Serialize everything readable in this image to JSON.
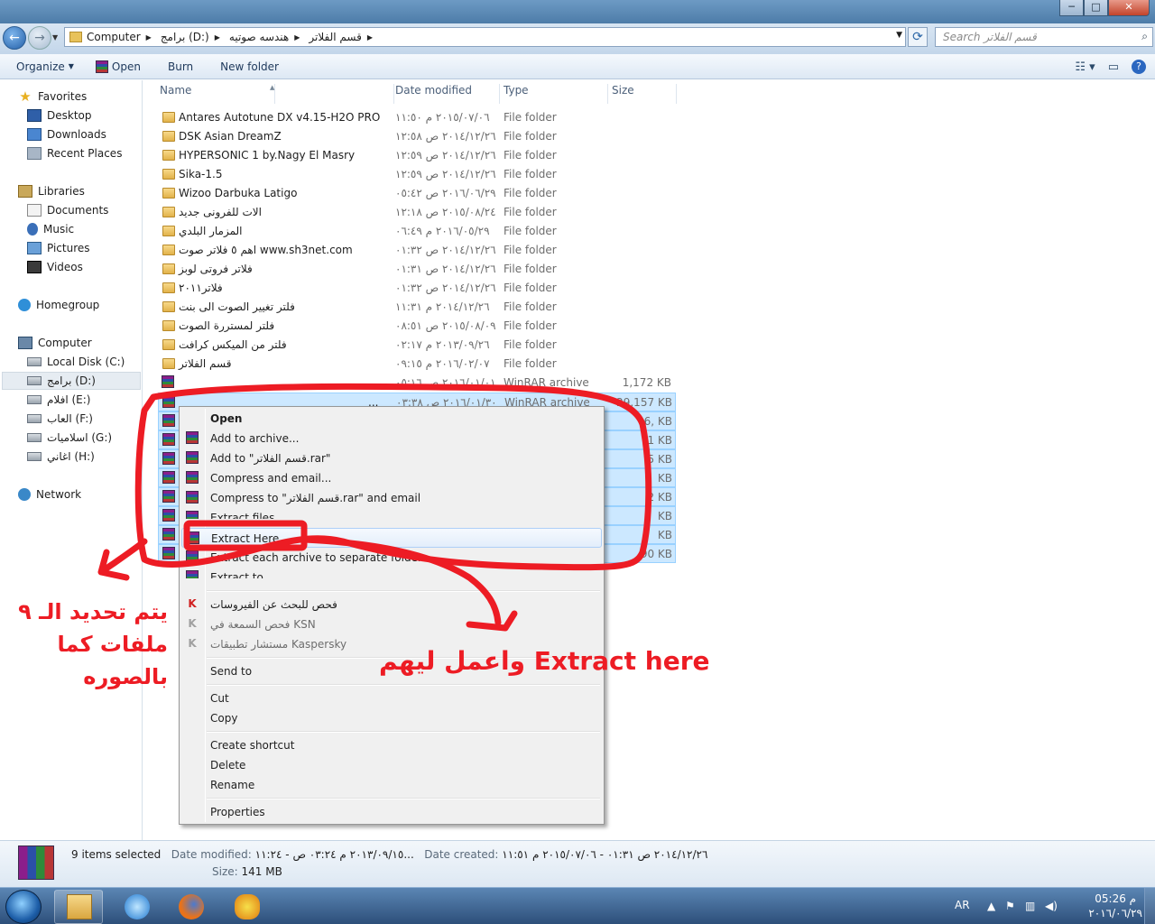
{
  "window": {
    "minimize": "─",
    "maximize": "□",
    "close": "✕"
  },
  "address": {
    "crumbs": [
      "Computer",
      "برامج (D:)",
      "هندسه صوتيه",
      "قسم الفلاتر"
    ],
    "search_placeholder": "Search قسم الفلاتر"
  },
  "toolbar": {
    "organize": "Organize",
    "open": "Open",
    "burn": "Burn",
    "new_folder": "New folder"
  },
  "nav": {
    "favorites": "Favorites",
    "desktop": "Desktop",
    "downloads": "Downloads",
    "recent": "Recent Places",
    "libraries": "Libraries",
    "documents": "Documents",
    "music": "Music",
    "pictures": "Pictures",
    "videos": "Videos",
    "homegroup": "Homegroup",
    "computer": "Computer",
    "disk_c": "Local Disk (C:)",
    "disk_d": "برامج (D:)",
    "disk_e": "افلام (E:)",
    "disk_f": "العاب (F:)",
    "disk_g": "اسلاميات (G:)",
    "disk_h": "اغاني (H:)",
    "network": "Network"
  },
  "columns": {
    "name": "Name",
    "date": "Date modified",
    "type": "Type",
    "size": "Size"
  },
  "folders": [
    {
      "name": "Antares Autotune DX v4.15-H2O PRO",
      "date": "٢٠١٥/٠٧/٠٦ م ١١:٥٠",
      "type": "File folder"
    },
    {
      "name": "DSK Asian DreamZ",
      "date": "٢٠١٤/١٢/٢٦ ص ١٢:٥٨",
      "type": "File folder"
    },
    {
      "name": "HYPERSONIC 1 by.Nagy El Masry",
      "date": "٢٠١٤/١٢/٢٦ ص ١٢:٥٩",
      "type": "File folder"
    },
    {
      "name": "Sika-1.5",
      "date": "٢٠١٤/١٢/٢٦ ص ١٢:٥٩",
      "type": "File folder"
    },
    {
      "name": "Wizoo Darbuka Latigo",
      "date": "٢٠١٦/٠٦/٢٩ ص ٠٥:٤٢",
      "type": "File folder"
    },
    {
      "name": "الات للفرونى جديد",
      "date": "٢٠١٥/٠٨/٢٤ ص ١٢:١٨",
      "type": "File folder"
    },
    {
      "name": "المزمار البلدي",
      "date": "٢٠١٦/٠٥/٢٩ م ٠٦:٤٩",
      "type": "File folder"
    },
    {
      "name": "اهم ٥ فلاتر صوت www.sh3net.com",
      "date": "٢٠١٤/١٢/٢٦ ص ٠١:٣٢",
      "type": "File folder"
    },
    {
      "name": "فلاتر فروتى لوبز",
      "date": "٢٠١٤/١٢/٢٦ ص ٠١:٣١",
      "type": "File folder"
    },
    {
      "name": "فلاتر٢٠١١",
      "date": "٢٠١٤/١٢/٢٦ ص ٠١:٣٢",
      "type": "File folder"
    },
    {
      "name": "فلتر تغيير الصوت الى بنت",
      "date": "٢٠١٤/١٢/٢٦ م ١١:٣١",
      "type": "File folder"
    },
    {
      "name": "فلتر لمستررة الصوت",
      "date": "٢٠١٥/٠٨/٠٩ ص ٠٨:٥١",
      "type": "File folder"
    },
    {
      "name": "فلتر من الميكس كرافت",
      "date": "٢٠١٣/٠٩/٢٦ م ٠٢:١٧",
      "type": "File folder"
    },
    {
      "name": "قسم الفلاتر",
      "date": "٢٠١٦/٠٢/٠٧ م ٠٩:١٥",
      "type": "File folder"
    }
  ],
  "archives": [
    {
      "date": "٢٠١٦/٠١/٠١ ص ٠٥:١٦",
      "type": "WinRAR archive",
      "size": "1,172 KB",
      "selected": false
    },
    {
      "name": "...",
      "date": "٢٠١٦/٠١/٣٠ ص ٠٣:٣٨",
      "type": "WinRAR archive",
      "size": "29,157 KB",
      "selected": true
    },
    {
      "size": "6,  KB",
      "selected": true
    },
    {
      "size": "1  KB",
      "selected": true
    },
    {
      "size": "5  KB",
      "selected": true
    },
    {
      "size": "KB",
      "selected": true
    },
    {
      "size": "2  KB",
      "selected": true
    },
    {
      "size": "KB",
      "selected": true
    },
    {
      "size": "  KB",
      "selected": true
    },
    {
      "size": "90 KB",
      "selected": true
    }
  ],
  "context_menu": {
    "open": "Open",
    "add_archive": "Add to archive...",
    "add_to": "Add to \"قسم الفلاتر.rar\"",
    "compress_email": "Compress and email...",
    "compress_to": "Compress to \"قسم الفلاتر.rar\" and email",
    "extract_files": "Extract files...",
    "extract_here": "Extract Here",
    "extract_each": "Extract each archive to separate folder",
    "extract_to": "Extract to",
    "k_scan": "فحص للبحث عن الفيروسات",
    "k_ksn": "فحص السمعة في KSN",
    "k_apps": "مستشار تطبيقات Kaspersky",
    "send_to": "Send to",
    "cut": "Cut",
    "copy": "Copy",
    "create_shortcut": "Create shortcut",
    "delete": "Delete",
    "rename": "Rename",
    "properties": "Properties"
  },
  "annotations": {
    "left_note": "يتم تحديد الـ ٩ ملفات كما بالصوره",
    "right_note": "واعمل ليهم Extract here",
    "color": "#ed1c24"
  },
  "details": {
    "selected": "9 items selected",
    "modified_label": "Date modified:",
    "modified_value": "٢٠١٣/٠٩/١٥ م ٠٣:٢٤ ص - ١١:٢٤...",
    "created_label": "Date created:",
    "created_value": "٢٠١٤/١٢/٢٦ ص ٠١:٣١ - ٢٠١٥/٠٧/٠٦ م ١١:٥١",
    "size_label": "Size:",
    "size_value": "141 MB"
  },
  "taskbar": {
    "lang": "AR",
    "time": "05:26 م",
    "date": "٢٠١٦/٠٦/٢٩"
  }
}
